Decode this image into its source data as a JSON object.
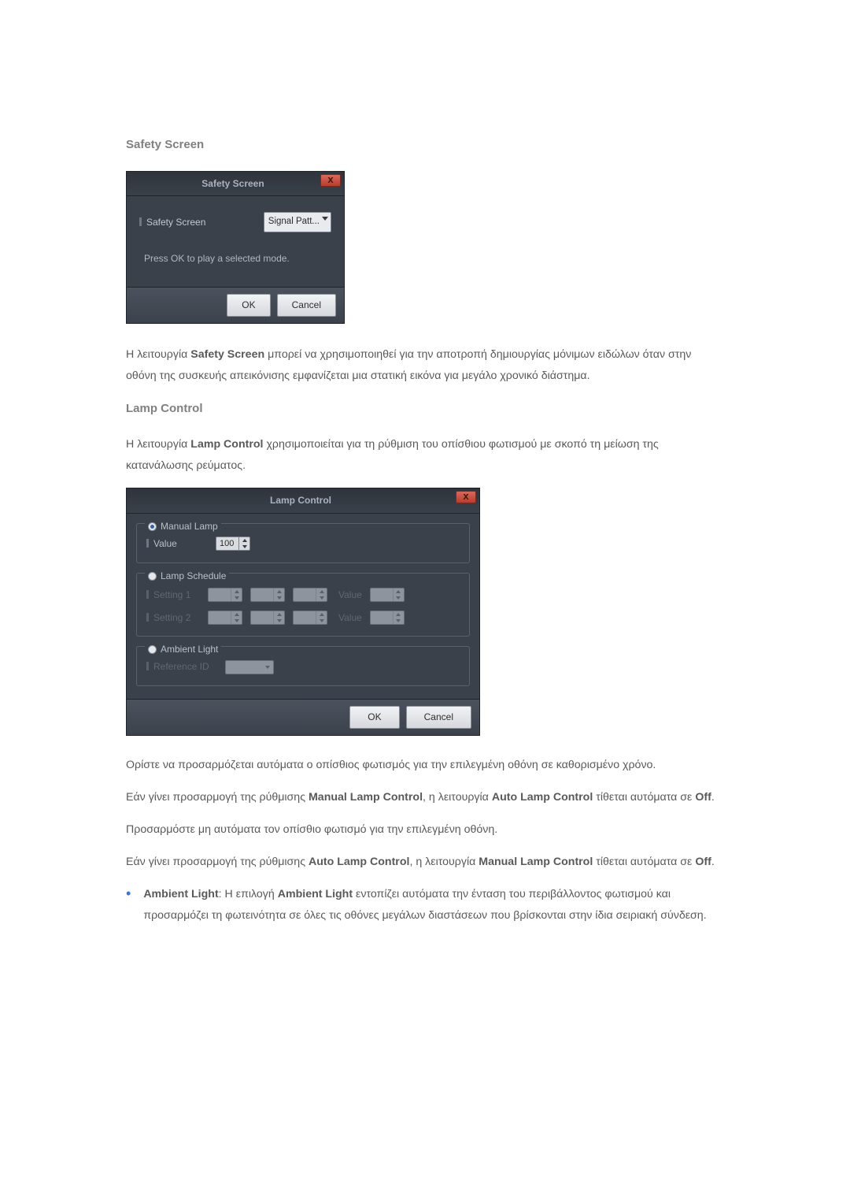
{
  "safety": {
    "heading": "Safety Screen",
    "dialog": {
      "title": "Safety Screen",
      "field_label": "Safety Screen",
      "combo_value": "Signal Patt...",
      "hint": "Press OK to play a selected mode.",
      "ok": "OK",
      "cancel": "Cancel"
    },
    "para": {
      "prefix": "Η λειτουργία ",
      "bold": "Safety Screen",
      "suffix": " μπορεί να χρησιμοποιηθεί για την αποτροπή δημιουργίας μόνιμων ειδώλων όταν στην οθόνη της συσκευής απεικόνισης εμφανίζεται μια στατική εικόνα για μεγάλο χρονικό διάστημα."
    }
  },
  "lamp": {
    "heading": "Lamp Control",
    "intro": {
      "prefix": "Η λειτουργία ",
      "bold": "Lamp Control",
      "suffix": " χρησιμοποιείται για τη ρύθμιση του οπίσθιου φωτισμού με σκοπό τη μείωση της κατανάλωσης ρεύματος."
    },
    "dialog": {
      "title": "Lamp Control",
      "manual_group": "Manual Lamp",
      "manual_value_label": "Value",
      "manual_value": "100",
      "schedule_group": "Lamp Schedule",
      "setting1": "Setting 1",
      "setting2": "Setting 2",
      "value_label": "Value",
      "ambient_group": "Ambient Light",
      "reference_label": "Reference ID",
      "ok": "OK",
      "cancel": "Cancel"
    },
    "para1": "Ορίστε να προσαρμόζεται αυτόματα ο οπίσθιος φωτισμός για την επιλεγμένη οθόνη σε καθορισμένο χρόνο.",
    "para2": {
      "p1": "Εάν γίνει προσαρμογή της ρύθμισης ",
      "b1": "Manual Lamp Control",
      "p2": ", η λειτουργία ",
      "b2": "Auto Lamp Control",
      "p3": " τίθεται αυτόματα σε ",
      "b3": "Off",
      "p4": "."
    },
    "para3": "Προσαρμόστε μη αυτόματα τον οπίσθιο φωτισμό για την επιλεγμένη οθόνη.",
    "para4": {
      "p1": "Εάν γίνει προσαρμογή της ρύθμισης ",
      "b1": "Auto Lamp Control",
      "p2": ", η λειτουργία ",
      "b2": "Manual Lamp Control",
      "p3": " τίθεται αυτόματα σε ",
      "b3": "Off",
      "p4": "."
    },
    "bullet": {
      "b1": "Ambient Light",
      "p1": ": Η επιλογή ",
      "b2": "Ambient Light",
      "p2": " εντοπίζει αυτόματα την ένταση του περιβάλλοντος φωτισμού και προσαρμόζει τη φωτεινότητα σε όλες τις οθόνες μεγάλων διαστάσεων που βρίσκονται στην ίδια σειριακή σύνδεση."
    }
  }
}
